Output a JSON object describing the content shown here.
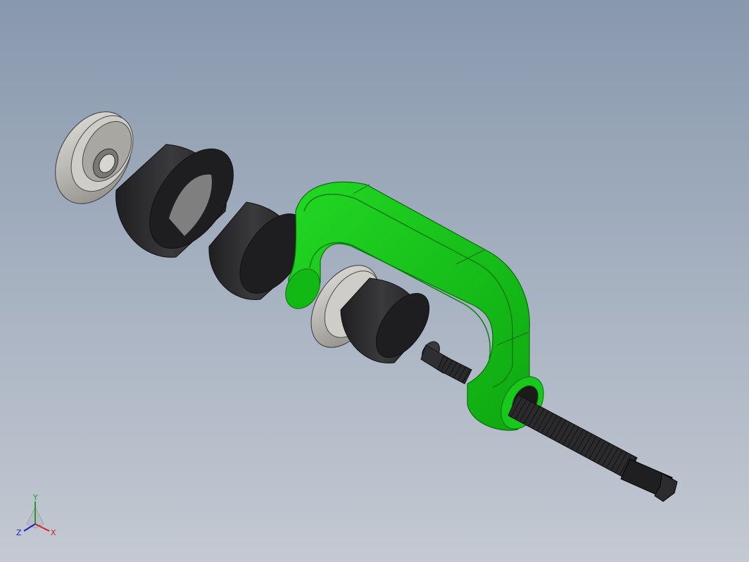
{
  "viewport": {
    "background_top": "#8898ad",
    "background_bottom": "#c4c9d2"
  },
  "model": {
    "parts": [
      {
        "name": "flanged-adapter-left",
        "color": "#b9b7b2"
      },
      {
        "name": "receiver-cup-large",
        "color": "#2e2e30"
      },
      {
        "name": "receiver-cup-medium",
        "color": "#2e2e30"
      },
      {
        "name": "c-frame",
        "color": "#12c114"
      },
      {
        "name": "flanged-adapter-center",
        "color": "#b9b7b2"
      },
      {
        "name": "receiver-cup-small",
        "color": "#2e2e30"
      },
      {
        "name": "forcing-screw",
        "color": "#2a2a2c"
      }
    ]
  },
  "triad": {
    "x_label": "X",
    "y_label": "Y",
    "z_label": "Z",
    "x_color": "#d02020",
    "y_color": "#20a020",
    "z_color": "#2020c0"
  }
}
